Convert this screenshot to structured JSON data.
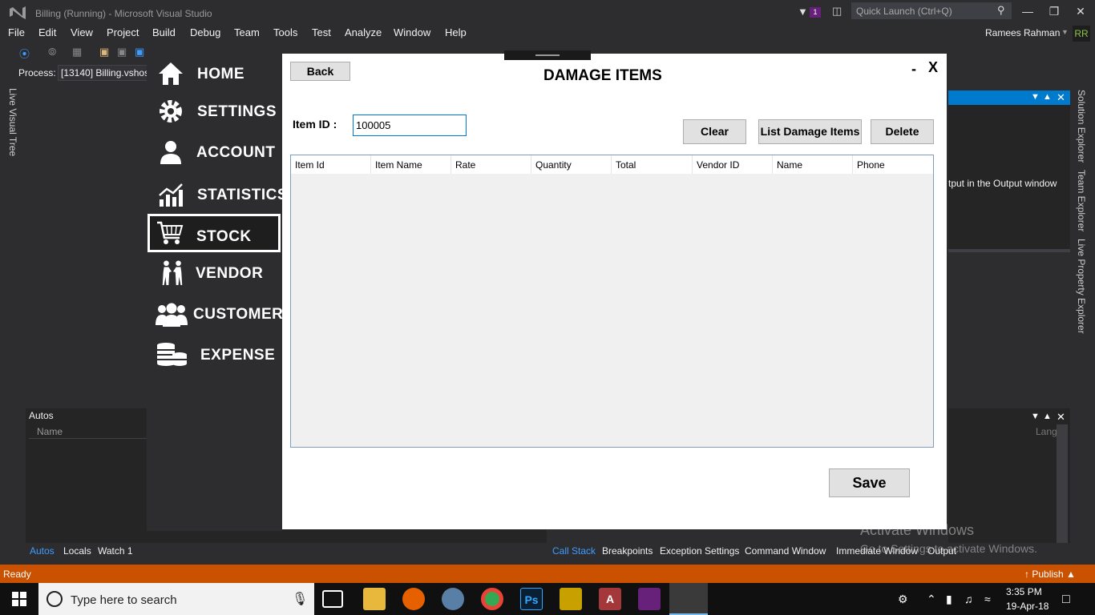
{
  "vs": {
    "title": "Billing (Running) - Microsoft Visual Studio",
    "notification_count": "1",
    "quick_launch_placeholder": "Quick Launch (Ctrl+Q)",
    "menu": [
      "File",
      "Edit",
      "View",
      "Project",
      "Build",
      "Debug",
      "Team",
      "Tools",
      "Test",
      "Analyze",
      "Window",
      "Help"
    ],
    "user_name": "Ramees Rahman",
    "user_initials": "RR",
    "process_label": "Process:",
    "process_value": "[13140] Billing.vshost.exe",
    "left_vertical_tab": "Live Visual Tree",
    "right_vertical_tabs": [
      "Solution Explorer",
      "Team Explorer",
      "Live Property Explorer"
    ],
    "output_hint": "tput in the Output window",
    "autos": {
      "title": "Autos",
      "col_name": "Name",
      "col_lang": "Lang"
    },
    "bottom_left_tabs": [
      "Autos",
      "Locals",
      "Watch 1"
    ],
    "bottom_right_tabs": [
      "Call Stack",
      "Breakpoints",
      "Exception Settings",
      "Command Window",
      "Immediate Window",
      "Output"
    ],
    "status_ready": "Ready",
    "status_publish": "Publish",
    "accent_color": "#007acc",
    "status_color": "#ca5100"
  },
  "watermark": {
    "title": "Activate Windows",
    "subtitle": "Go to Settings to activate Windows."
  },
  "taskbar": {
    "search_placeholder": "Type here to search",
    "time": "3:35 PM",
    "date": "19-Apr-18"
  },
  "sidebar": {
    "items": [
      {
        "label": "HOME",
        "icon": "home-icon"
      },
      {
        "label": "SETTINGS",
        "icon": "gear-icon"
      },
      {
        "label": "ACCOUNT",
        "icon": "user-icon"
      },
      {
        "label": "STATISTICS",
        "icon": "chart-icon"
      },
      {
        "label": "STOCK",
        "icon": "cart-icon",
        "active": true
      },
      {
        "label": "VENDOR",
        "icon": "handshake-icon"
      },
      {
        "label": "CUSTOMER",
        "icon": "group-icon"
      },
      {
        "label": "EXPENSE",
        "icon": "coins-icon"
      }
    ]
  },
  "form": {
    "back_label": "Back",
    "title": "DAMAGE ITEMS",
    "minimize_label": "-",
    "close_label": "X",
    "item_id_label": "Item ID :",
    "item_id_value": "100005",
    "clear_label": "Clear",
    "list_label": "List Damage Items",
    "delete_label": "Delete",
    "grid_columns": [
      "Item Id",
      "Item Name",
      "Rate",
      "Quantity",
      "Total",
      "Vendor ID",
      "Name",
      "Phone"
    ],
    "save_label": "Save"
  }
}
